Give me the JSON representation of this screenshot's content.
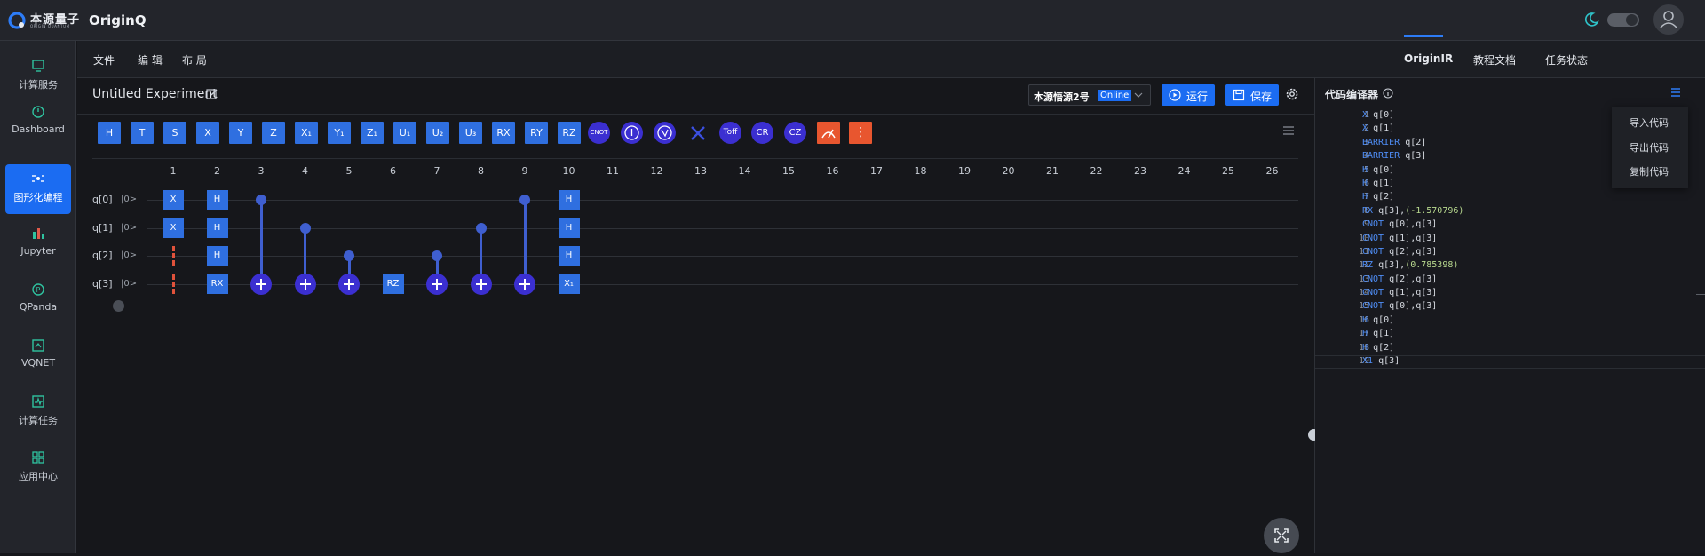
{
  "header": {
    "brand_cn": "本源量子",
    "brand_en": "ORIGIN QUANTUM",
    "app_name": "OriginQ"
  },
  "sidebar": {
    "items": [
      {
        "label": "计算服务",
        "icon": "monitor-icon"
      },
      {
        "label": "Dashboard",
        "icon": "gauge-icon"
      },
      {
        "label": "图形化编程",
        "icon": "circuit-icon",
        "active": true
      },
      {
        "label": "Jupyter",
        "icon": "bar-chart-icon"
      },
      {
        "label": "QPanda",
        "icon": "p-circle-icon"
      },
      {
        "label": "VQNET",
        "icon": "vqnet-icon"
      },
      {
        "label": "计算任务",
        "icon": "activity-icon"
      },
      {
        "label": "应用中心",
        "icon": "apps-grid-icon"
      }
    ]
  },
  "menubar": {
    "items": [
      "文件",
      "编 辑",
      "布 局"
    ],
    "right_tabs": [
      "OriginIR",
      "教程文档",
      "任务状态"
    ]
  },
  "workspace": {
    "title": "Untitled Experiment",
    "backend": {
      "name": "本源悟源2号",
      "status": "Online"
    },
    "run_label": "运行",
    "save_label": "保存"
  },
  "palette": {
    "gates": [
      "H",
      "T",
      "S",
      "X",
      "Y",
      "Z",
      "X₁",
      "Y₁",
      "Z₁",
      "U₁",
      "U₂",
      "U₃",
      "RX",
      "RY",
      "RZ"
    ],
    "round_gates": [
      "CNOT",
      "",
      "",
      "",
      "Toff",
      "CR",
      "CZ"
    ]
  },
  "circuit": {
    "columns": [
      "1",
      "2",
      "3",
      "4",
      "5",
      "6",
      "7",
      "8",
      "9",
      "10",
      "11",
      "12",
      "13",
      "14",
      "15",
      "16",
      "17",
      "18",
      "19",
      "20",
      "21",
      "22",
      "23",
      "24",
      "25",
      "26"
    ],
    "qubits": [
      {
        "label": "q[0]",
        "init": "|0>"
      },
      {
        "label": "q[1]",
        "init": "|0>"
      },
      {
        "label": "q[2]",
        "init": "|0>"
      },
      {
        "label": "q[3]",
        "init": "|0>"
      }
    ],
    "gates": [
      {
        "col": 1,
        "qubit": 0,
        "name": "X"
      },
      {
        "col": 1,
        "qubit": 1,
        "name": "X"
      },
      {
        "col": 2,
        "qubit": 0,
        "name": "H"
      },
      {
        "col": 2,
        "qubit": 1,
        "name": "H"
      },
      {
        "col": 2,
        "qubit": 2,
        "name": "H"
      },
      {
        "col": 2,
        "qubit": 3,
        "name": "RX"
      },
      {
        "col": 6,
        "qubit": 3,
        "name": "RZ"
      },
      {
        "col": 10,
        "qubit": 0,
        "name": "H"
      },
      {
        "col": 10,
        "qubit": 1,
        "name": "H"
      },
      {
        "col": 10,
        "qubit": 2,
        "name": "H"
      },
      {
        "col": 10,
        "qubit": 3,
        "name": "X₁"
      }
    ],
    "cnots": [
      {
        "col": 3,
        "control": 0,
        "target": 3
      },
      {
        "col": 4,
        "control": 1,
        "target": 3
      },
      {
        "col": 5,
        "control": 2,
        "target": 3
      },
      {
        "col": 7,
        "control": 2,
        "target": 3
      },
      {
        "col": 8,
        "control": 1,
        "target": 3
      },
      {
        "col": 9,
        "control": 0,
        "target": 3
      }
    ],
    "barriers": [
      {
        "col": 1,
        "qubit": 2
      },
      {
        "col": 1,
        "qubit": 3
      }
    ]
  },
  "code_panel": {
    "title": "代码编译器",
    "menu": [
      "导入代码",
      "导出代码",
      "复制代码"
    ],
    "lines": [
      {
        "kw": "X",
        "arg": "q[0]",
        "num": ""
      },
      {
        "kw": "X",
        "arg": "q[1]",
        "num": ""
      },
      {
        "kw": "BARRIER",
        "arg": "q[2]",
        "num": ""
      },
      {
        "kw": "BARRIER",
        "arg": "q[3]",
        "num": ""
      },
      {
        "kw": "H",
        "arg": "q[0]",
        "num": ""
      },
      {
        "kw": "H",
        "arg": "q[1]",
        "num": ""
      },
      {
        "kw": "H",
        "arg": "q[2]",
        "num": ""
      },
      {
        "kw": "RX",
        "arg": "q[3],",
        "num": "(-1.570796)"
      },
      {
        "kw": "CNOT",
        "arg": "q[0],q[3]",
        "num": ""
      },
      {
        "kw": "CNOT",
        "arg": "q[1],q[3]",
        "num": ""
      },
      {
        "kw": "CNOT",
        "arg": "q[2],q[3]",
        "num": ""
      },
      {
        "kw": "RZ",
        "arg": "q[3],",
        "num": "(0.785398)"
      },
      {
        "kw": "CNOT",
        "arg": "q[2],q[3]",
        "num": ""
      },
      {
        "kw": "CNOT",
        "arg": "q[1],q[3]",
        "num": ""
      },
      {
        "kw": "CNOT",
        "arg": "q[0],q[3]",
        "num": ""
      },
      {
        "kw": "H",
        "arg": "q[0]",
        "num": ""
      },
      {
        "kw": "H",
        "arg": "q[1]",
        "num": ""
      },
      {
        "kw": "H",
        "arg": "q[2]",
        "num": ""
      },
      {
        "kw": "X1",
        "arg": "q[3]",
        "num": ""
      }
    ]
  },
  "colors": {
    "accent": "#1b6cf2",
    "gate": "#2f6fe0",
    "gate_round": "#3b2fd1",
    "barrier": "#e0523b",
    "measure": "#e8562f"
  }
}
